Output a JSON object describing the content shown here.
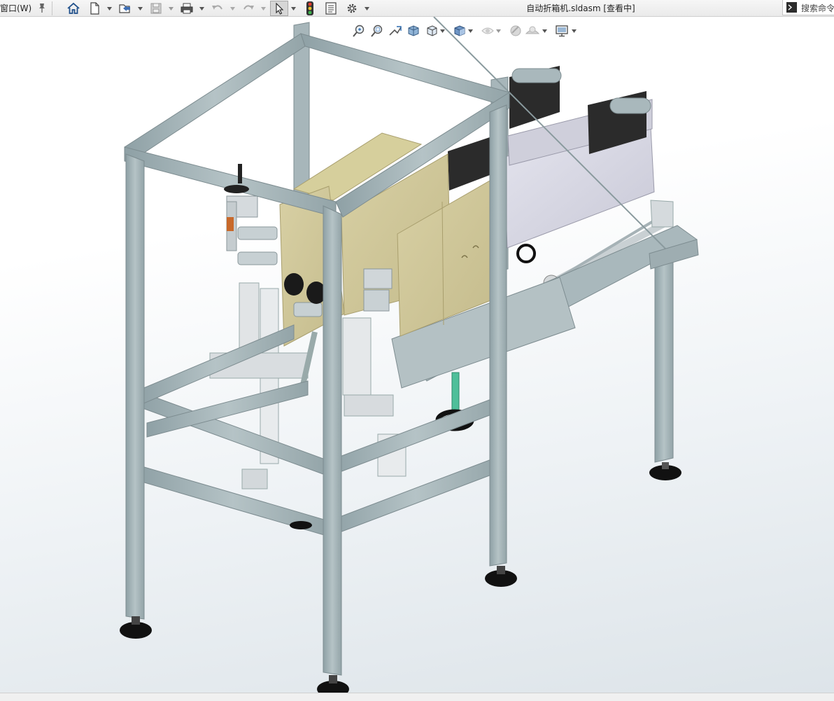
{
  "menu": {
    "window_label": "窗口(W)"
  },
  "document": {
    "title": "自动折箱机.sldasm [查看中]"
  },
  "search": {
    "placeholder": "搜索命令"
  },
  "toolbar": {
    "buttons": [
      "home-icon",
      "new-document-icon",
      "open-icon",
      "save-icon",
      "print-icon",
      "undo-icon",
      "redo-icon",
      "select-icon",
      "traffic-light-icon",
      "file-properties-icon",
      "gear-icon"
    ]
  },
  "view_toolbar": {
    "buttons": [
      "zoom-to-fit-icon",
      "zoom-to-area-icon",
      "previous-view-icon",
      "section-view-icon",
      "view-orientation-icon",
      "display-style-icon",
      "hide-show-icon",
      "edit-appearance-icon",
      "apply-scene-icon",
      "view-settings-icon"
    ]
  },
  "colors": {
    "frame": "#a9b8bc",
    "frame_dark": "#8a9a9e",
    "carton": "#cfc79a",
    "conveyor_belt": "#2b2b2b",
    "guide_panel": "#d9d9e6",
    "pneumatic": "#4fbf9a",
    "feet": "#111111",
    "select_highlight": "#d6d6d6"
  }
}
